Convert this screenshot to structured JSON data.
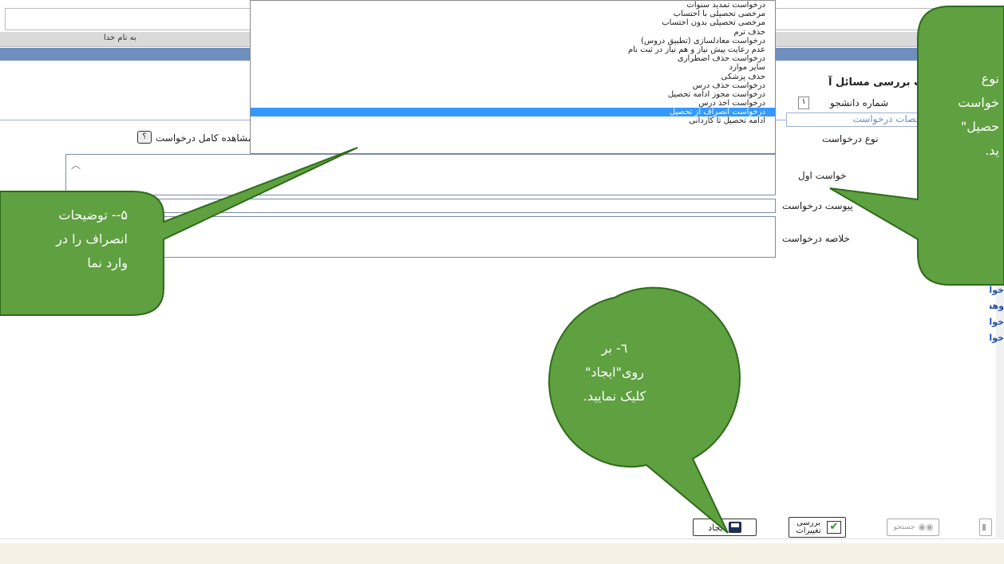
{
  "header": {
    "bismillah": "به نام خدا"
  },
  "form": {
    "title": "خواست بررسی مسائل آ",
    "student_number_label": "شماره دانشجو",
    "student_number_value": "۱",
    "legend": "خصات درخواست",
    "request_type_label": "نوع درخواست",
    "view_full_request": "مشاهده کامل درخواست",
    "help_icon_text": "؟",
    "first_request_desc_label": "خواست اول",
    "attachment_label": "پیوست درخواست",
    "summary_label": "خلاصه درخواست"
  },
  "dropdown": {
    "options": [
      "درخواست تمدید سنوات",
      "مرخصی تحصیلی با احتساب",
      "مرخصی تحصیلی بدون احتساب",
      "حذف ترم",
      "درخواست معادلسازی (تطبیق دروس)",
      "عدم رعایت پیش نیاز و هم نیاز در ثبت نام",
      "درخواست حذف اضطراری",
      "سایر موارد",
      "حذف پزشکی",
      "درخواست حذف درس",
      "درخواست مجوز ادامه تحصیل",
      "درخواست اخذ درس",
      "درخواست انصراف از تحصیل",
      "ادامه تحصیل تا کاردانی"
    ],
    "selected_index": 12
  },
  "side_links": [
    "خوا",
    "خوا",
    "وهش",
    "خوا",
    "خوا"
  ],
  "buttons": {
    "create": "ایجاد",
    "review": "بررسی تغییرات",
    "search": "جستجو"
  },
  "callouts": {
    "top_right": [
      "نوع",
      "خواست",
      "حصیل\"",
      "ید."
    ],
    "left": [
      "۵-- توضیحات",
      "انصراف را در",
      "وارد نما"
    ],
    "bottom": [
      "٦- بر",
      "روی\"ایجاد\"",
      "کلیک نمایید."
    ]
  },
  "colors": {
    "callout_fill": "#5fa040",
    "callout_stroke": "#2f6b1a",
    "selection": "#3399ff",
    "header_blue": "#6f8fbf"
  }
}
